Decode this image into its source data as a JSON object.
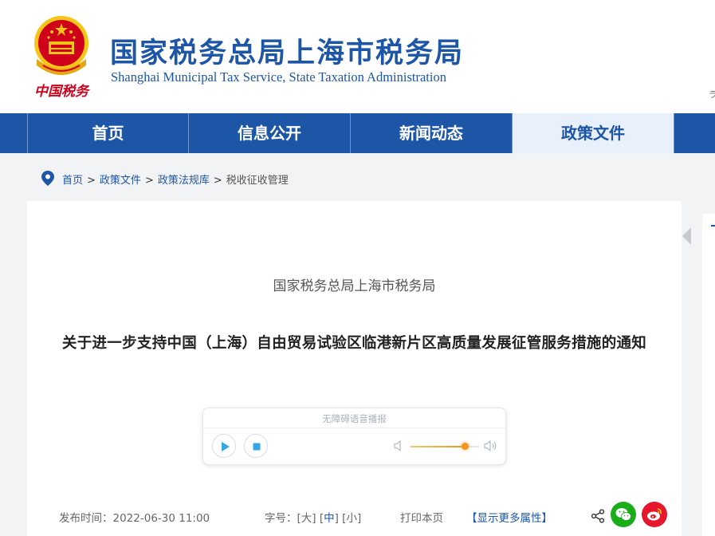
{
  "header": {
    "title": "国家税务总局上海市税务局",
    "subtitle": "Shanghai Municipal Tax Service, State Taxation Administration",
    "emblem_text": "中国税务",
    "edge_char": "ラ"
  },
  "nav": {
    "items": [
      {
        "label": "首页"
      },
      {
        "label": "信息公开"
      },
      {
        "label": "新闻动态"
      },
      {
        "label": "政策文件"
      }
    ],
    "active_index": 3
  },
  "breadcrumb": {
    "items": [
      "首页",
      "政策文件",
      "政策法规库"
    ],
    "current": "税收征收管理",
    "separator": ">"
  },
  "article": {
    "issuer": "国家税务总局上海市税务局",
    "title": "关于进一步支持中国（上海）自由贸易试验区临港新片区高质量发展征管服务措施的通知"
  },
  "audio_player": {
    "label": "无障碍语音播报",
    "volume": 0.79
  },
  "meta": {
    "date_label": "发布时间：2022-06-30 11:00",
    "font_size_label": "字号：",
    "font_sizes": [
      "大",
      "中",
      "小"
    ],
    "font_size_selected": "中",
    "print_label": "打印本页",
    "more_label": "【显示更多属性】"
  },
  "icons": {
    "nav_pin": "location-pin-icon",
    "collapse": "collapse-arrows-icon",
    "play": "play-icon",
    "stop": "stop-icon",
    "volume_low": "volume-low-icon",
    "volume_high": "volume-high-icon",
    "share": "share-icon",
    "wechat": "wechat-icon",
    "weibo": "weibo-icon"
  },
  "colors": {
    "brand_blue": "#1e56a7",
    "nav_active_bg": "#e8f0fb",
    "emblem_red": "#d0021b",
    "slider_orange": "#f7941d",
    "wechat_green": "#1aad19",
    "weibo_red": "#e6162d"
  }
}
